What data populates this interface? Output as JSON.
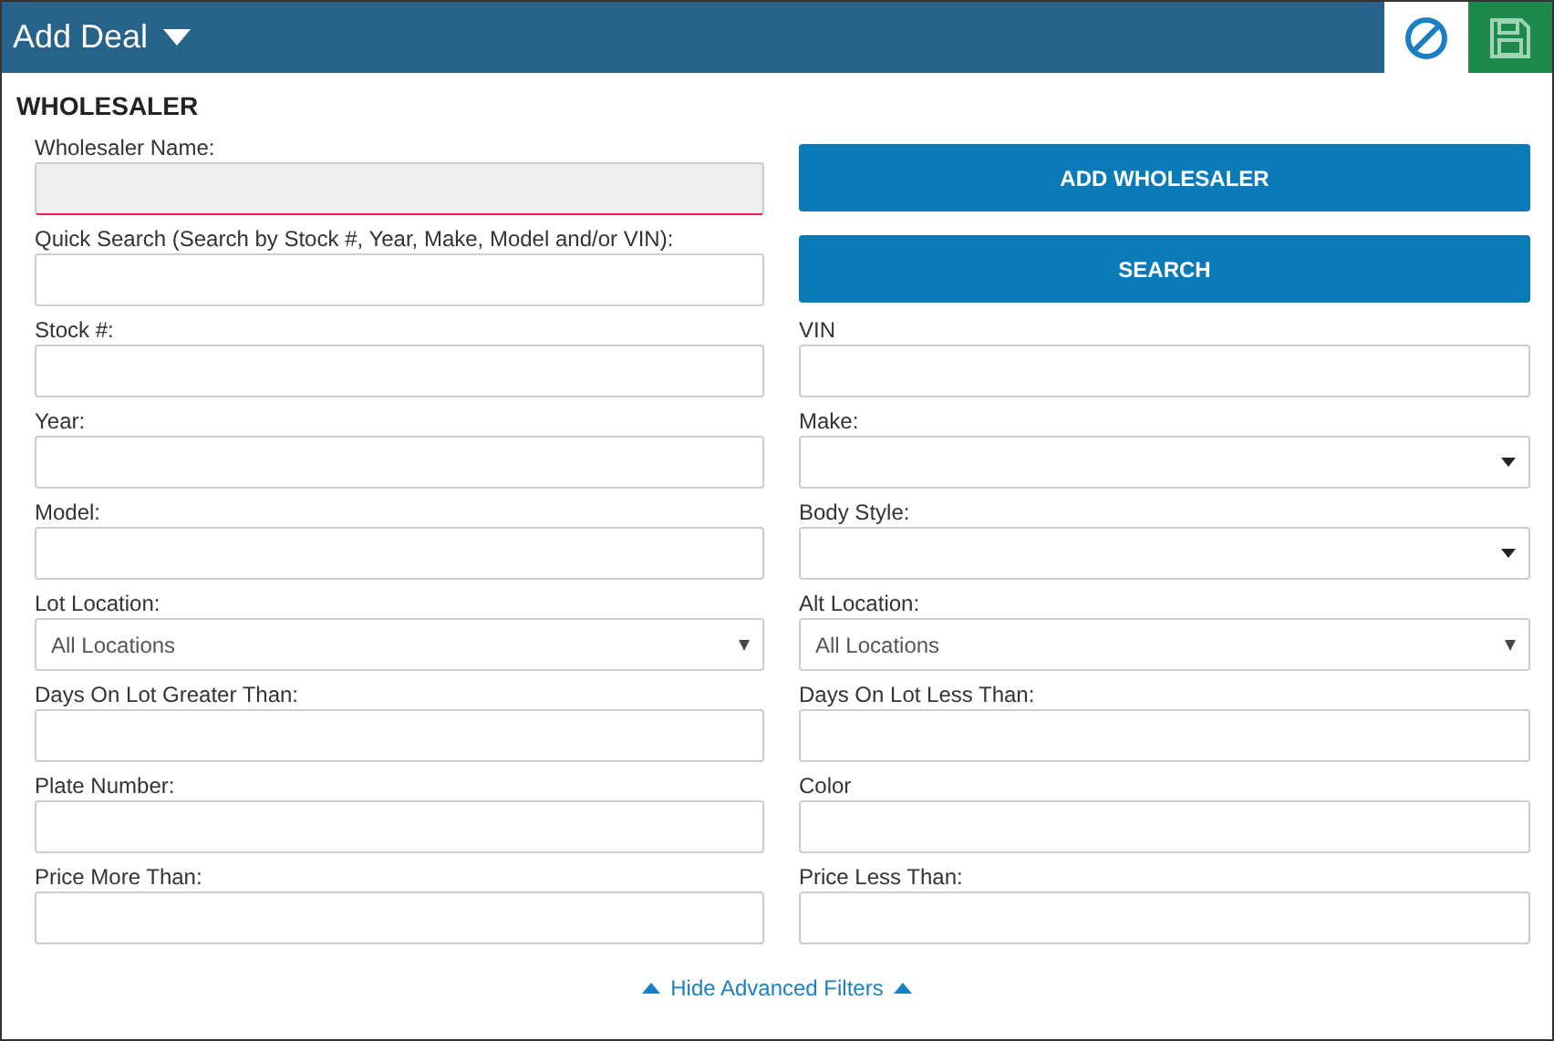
{
  "header": {
    "title": "Add Deal"
  },
  "section_title": "WHOLESALER",
  "cells": [
    {
      "kind": "text",
      "label": "Wholesaler Name:",
      "invalid": true
    },
    {
      "kind": "button",
      "label": "ADD WHOLESALER"
    },
    {
      "kind": "text",
      "label": "Quick Search (Search by Stock #, Year, Make, Model and/or VIN):",
      "invalid": false
    },
    {
      "kind": "button",
      "label": "SEARCH"
    },
    {
      "kind": "text",
      "label": "Stock #:",
      "invalid": false
    },
    {
      "kind": "text",
      "label": "VIN",
      "invalid": false
    },
    {
      "kind": "text",
      "label": "Year:",
      "invalid": false
    },
    {
      "kind": "select",
      "label": "Make:"
    },
    {
      "kind": "text",
      "label": "Model:",
      "invalid": false
    },
    {
      "kind": "select",
      "label": "Body Style:"
    },
    {
      "kind": "dropdown",
      "label": "Lot Location:",
      "value": "All Locations"
    },
    {
      "kind": "dropdown",
      "label": "Alt Location:",
      "value": "All Locations"
    },
    {
      "kind": "text",
      "label": "Days On Lot Greater Than:",
      "invalid": false
    },
    {
      "kind": "text",
      "label": "Days On Lot Less Than:",
      "invalid": false
    },
    {
      "kind": "text",
      "label": "Plate Number:",
      "invalid": false
    },
    {
      "kind": "text",
      "label": "Color",
      "invalid": false
    },
    {
      "kind": "text",
      "label": "Price More Than:",
      "invalid": false
    },
    {
      "kind": "text",
      "label": "Price Less Than:",
      "invalid": false
    }
  ],
  "footer_link": "Hide Advanced Filters"
}
